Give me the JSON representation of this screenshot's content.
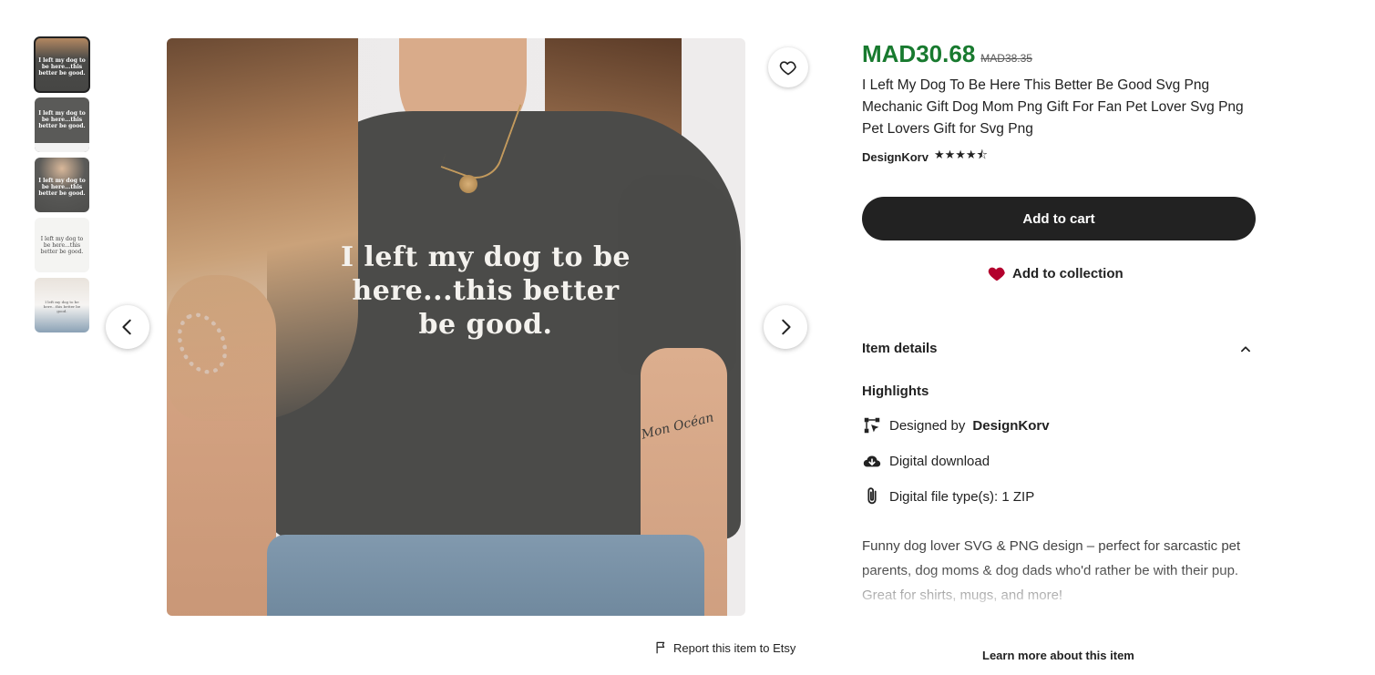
{
  "gallery": {
    "thumbnails": [
      {
        "caption": "I left my dog to be here...this better be good."
      },
      {
        "caption": "I left my dog to be here...this better be good."
      },
      {
        "caption": "I left my dog to be here...this better be good."
      },
      {
        "caption": "I left my dog to be here...this better be good."
      },
      {
        "caption": "I left my dog to be here...this better be good."
      }
    ],
    "shirt_text": "I left my dog to be here...this better be good.",
    "tattoo_text": "Mon Océan"
  },
  "report_label": "Report this item to Etsy",
  "listing": {
    "price": "MAD30.68",
    "original_price": "MAD38.35",
    "title": "I Left My Dog To Be Here This Better Be Good Svg Png Mechanic Gift Dog Mom Png Gift For Fan Pet Lover Svg Png Pet Lovers Gift for Svg Png",
    "shop_name": "DesignKorv",
    "rating_stars": "★★★★⯪",
    "rating_value": 4.5,
    "add_to_cart_label": "Add to cart",
    "add_to_collection_label": "Add to collection"
  },
  "item_details": {
    "header": "Item details",
    "highlights_label": "Highlights",
    "designed_by_prefix": "Designed by",
    "designer": "DesignKorv",
    "digital_download": "Digital download",
    "file_types": "Digital file type(s): 1 ZIP",
    "description": "Funny dog lover SVG & PNG design – perfect for sarcastic pet parents, dog moms & dog dads who'd rather be with their pup. Great for shirts, mugs, and more!",
    "learn_more_label": "Learn more about this item"
  },
  "colors": {
    "price_green": "#187a2f",
    "button_dark": "#222222",
    "heart_red": "#b3002d"
  }
}
